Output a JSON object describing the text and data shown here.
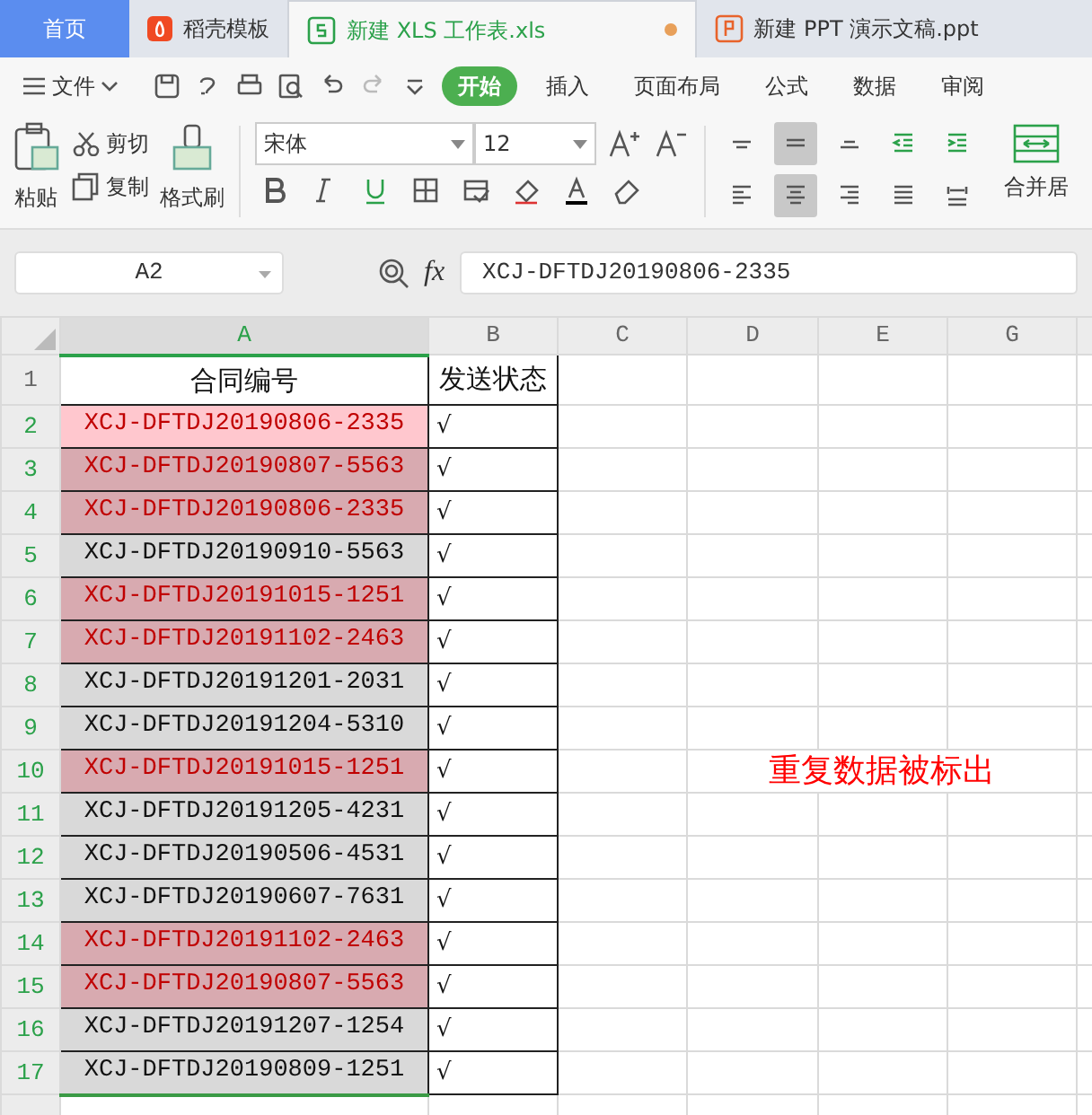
{
  "tabs": [
    {
      "label": "首页",
      "kind": "home",
      "selected": false,
      "unsaved": false
    },
    {
      "label": "稻壳模板",
      "kind": "docer",
      "selected": false,
      "unsaved": false
    },
    {
      "label": "新建 XLS 工作表.xls",
      "kind": "sheet",
      "selected": true,
      "unsaved": true
    },
    {
      "label": "新建 PPT 演示文稿.ppt",
      "kind": "slides",
      "selected": false,
      "unsaved": false
    }
  ],
  "file_menu": "文件",
  "menu_items": [
    {
      "label": "开始",
      "selected": true
    },
    {
      "label": "插入",
      "selected": false
    },
    {
      "label": "页面布局",
      "selected": false
    },
    {
      "label": "公式",
      "selected": false
    },
    {
      "label": "数据",
      "selected": false
    },
    {
      "label": "审阅",
      "selected": false
    }
  ],
  "clipboard": {
    "paste": "粘贴",
    "cut": "剪切",
    "copy": "复制",
    "format_painter": "格式刷"
  },
  "font_name": "宋体",
  "font_size": "12",
  "align_buttons": [
    {
      "kind": "top",
      "selected": false
    },
    {
      "kind": "middle",
      "selected": true
    },
    {
      "kind": "bottom",
      "selected": false
    },
    {
      "kind": "outdent",
      "selected": false
    },
    {
      "kind": "indent",
      "selected": false
    },
    {
      "kind": "left",
      "selected": false
    },
    {
      "kind": "center",
      "selected": true
    },
    {
      "kind": "right",
      "selected": false
    },
    {
      "kind": "justify",
      "selected": false
    },
    {
      "kind": "distribute",
      "selected": false
    }
  ],
  "merge": "合并居",
  "name_box": "A2",
  "formula": "XCJ-DFTDJ20190806-2335",
  "columns": [
    {
      "label": "A",
      "selected": true
    },
    {
      "label": "B",
      "selected": false
    },
    {
      "label": "C",
      "selected": false
    },
    {
      "label": "D",
      "selected": false
    },
    {
      "label": "E",
      "selected": false
    },
    {
      "label": "G",
      "selected": false
    }
  ],
  "header_row": {
    "number": "1",
    "cells": [
      "合同编号",
      "发送状态"
    ]
  },
  "rows": [
    {
      "number": "2",
      "id": "XCJ-DFTDJ20190806-2335",
      "status": "√",
      "duplicate": true,
      "active": true
    },
    {
      "number": "3",
      "id": "XCJ-DFTDJ20190807-5563",
      "status": "√",
      "duplicate": true,
      "active": false
    },
    {
      "number": "4",
      "id": "XCJ-DFTDJ20190806-2335",
      "status": "√",
      "duplicate": true,
      "active": false
    },
    {
      "number": "5",
      "id": "XCJ-DFTDJ20190910-5563",
      "status": "√",
      "duplicate": false,
      "active": false
    },
    {
      "number": "6",
      "id": "XCJ-DFTDJ20191015-1251",
      "status": "√",
      "duplicate": true,
      "active": false
    },
    {
      "number": "7",
      "id": "XCJ-DFTDJ20191102-2463",
      "status": "√",
      "duplicate": true,
      "active": false
    },
    {
      "number": "8",
      "id": "XCJ-DFTDJ20191201-2031",
      "status": "√",
      "duplicate": false,
      "active": false
    },
    {
      "number": "9",
      "id": "XCJ-DFTDJ20191204-5310",
      "status": "√",
      "duplicate": false,
      "active": false
    },
    {
      "number": "10",
      "id": "XCJ-DFTDJ20191015-1251",
      "status": "√",
      "duplicate": true,
      "active": false
    },
    {
      "number": "11",
      "id": "XCJ-DFTDJ20191205-4231",
      "status": "√",
      "duplicate": false,
      "active": false
    },
    {
      "number": "12",
      "id": "XCJ-DFTDJ20190506-4531",
      "status": "√",
      "duplicate": false,
      "active": false
    },
    {
      "number": "13",
      "id": "XCJ-DFTDJ20190607-7631",
      "status": "√",
      "duplicate": false,
      "active": false
    },
    {
      "number": "14",
      "id": "XCJ-DFTDJ20191102-2463",
      "status": "√",
      "duplicate": true,
      "active": false
    },
    {
      "number": "15",
      "id": "XCJ-DFTDJ20190807-5563",
      "status": "√",
      "duplicate": true,
      "active": false
    },
    {
      "number": "16",
      "id": "XCJ-DFTDJ20191207-1254",
      "status": "√",
      "duplicate": false,
      "active": false
    },
    {
      "number": "17",
      "id": "XCJ-DFTDJ20190809-1251",
      "status": "√",
      "duplicate": false,
      "active": false
    }
  ],
  "function_label": "fx",
  "annotation": "重复数据被标出"
}
